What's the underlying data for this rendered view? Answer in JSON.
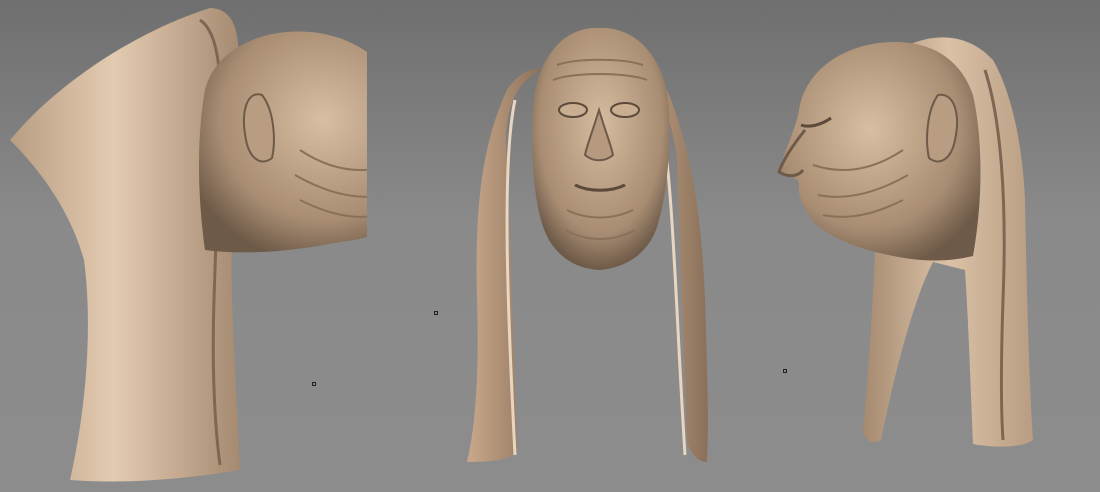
{
  "scene": {
    "views": [
      {
        "id": "left-profile",
        "facing": "right"
      },
      {
        "id": "front",
        "facing": "viewer"
      },
      {
        "id": "right-profile",
        "facing": "left"
      }
    ],
    "colors": {
      "background_top": "#6f6f6f",
      "background_bottom": "#8c8c8c",
      "sculpt_light": "#d9bfa3",
      "sculpt_mid": "#b89d82",
      "sculpt_shadow": "#6e5a48",
      "marker_border": "#222222"
    },
    "marker_count": 3
  }
}
